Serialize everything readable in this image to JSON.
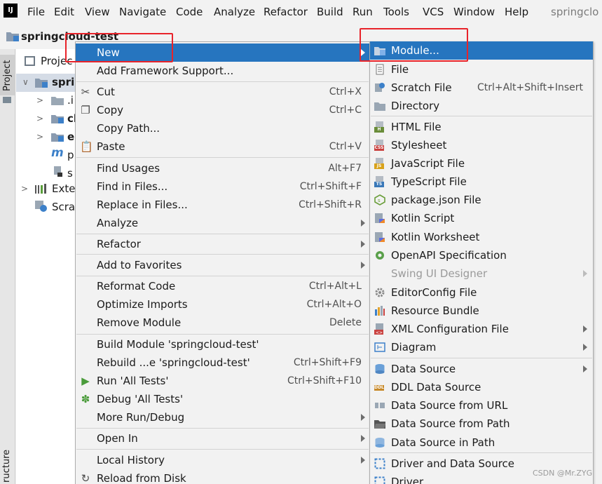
{
  "menubar": {
    "logo": "IJ",
    "items": [
      "File",
      "Edit",
      "View",
      "Navigate",
      "Code",
      "Analyze",
      "Refactor",
      "Build",
      "Run",
      "Tools",
      "VCS",
      "Window",
      "Help"
    ],
    "window_title": "springclo"
  },
  "breadcrumb": {
    "label": "springcloud-test"
  },
  "side_stripe": {
    "project": "Project",
    "structure": "ructure"
  },
  "project_panel": {
    "title": "Projec",
    "tree": [
      "sprin",
      ".i",
      "cl",
      "e",
      "p",
      "s",
      "Exter",
      "Scra"
    ]
  },
  "context_menu": {
    "items": [
      {
        "label": "New",
        "shortcut": ""
      },
      {
        "label": "Add Framework Support...",
        "shortcut": ""
      },
      {
        "label": "Cut",
        "shortcut": "Ctrl+X"
      },
      {
        "label": "Copy",
        "shortcut": "Ctrl+C"
      },
      {
        "label": "Copy Path...",
        "shortcut": ""
      },
      {
        "label": "Paste",
        "shortcut": "Ctrl+V"
      },
      {
        "label": "Find Usages",
        "shortcut": "Alt+F7"
      },
      {
        "label": "Find in Files...",
        "shortcut": "Ctrl+Shift+F"
      },
      {
        "label": "Replace in Files...",
        "shortcut": "Ctrl+Shift+R"
      },
      {
        "label": "Analyze",
        "shortcut": ""
      },
      {
        "label": "Refactor",
        "shortcut": ""
      },
      {
        "label": "Add to Favorites",
        "shortcut": ""
      },
      {
        "label": "Reformat Code",
        "shortcut": "Ctrl+Alt+L"
      },
      {
        "label": "Optimize Imports",
        "shortcut": "Ctrl+Alt+O"
      },
      {
        "label": "Remove Module",
        "shortcut": "Delete"
      },
      {
        "label": "Build Module 'springcloud-test'",
        "shortcut": ""
      },
      {
        "label": "Rebuild ...e 'springcloud-test'",
        "shortcut": "Ctrl+Shift+F9"
      },
      {
        "label": "Run 'All Tests'",
        "shortcut": "Ctrl+Shift+F10"
      },
      {
        "label": "Debug 'All Tests'",
        "shortcut": ""
      },
      {
        "label": "More Run/Debug",
        "shortcut": ""
      },
      {
        "label": "Open In",
        "shortcut": ""
      },
      {
        "label": "Local History",
        "shortcut": ""
      },
      {
        "label": "Reload from Disk",
        "shortcut": ""
      }
    ]
  },
  "new_submenu": {
    "items": [
      {
        "label": "Module...",
        "shortcut": ""
      },
      {
        "label": "File",
        "shortcut": ""
      },
      {
        "label": "Scratch File",
        "shortcut": "Ctrl+Alt+Shift+Insert"
      },
      {
        "label": "Directory",
        "shortcut": ""
      },
      {
        "label": "HTML File",
        "shortcut": ""
      },
      {
        "label": "Stylesheet",
        "shortcut": ""
      },
      {
        "label": "JavaScript File",
        "shortcut": ""
      },
      {
        "label": "TypeScript File",
        "shortcut": ""
      },
      {
        "label": "package.json File",
        "shortcut": ""
      },
      {
        "label": "Kotlin Script",
        "shortcut": ""
      },
      {
        "label": "Kotlin Worksheet",
        "shortcut": ""
      },
      {
        "label": "OpenAPI Specification",
        "shortcut": ""
      },
      {
        "label": "Swing UI Designer",
        "shortcut": ""
      },
      {
        "label": "EditorConfig File",
        "shortcut": ""
      },
      {
        "label": "Resource Bundle",
        "shortcut": ""
      },
      {
        "label": "XML Configuration File",
        "shortcut": ""
      },
      {
        "label": "Diagram",
        "shortcut": ""
      },
      {
        "label": "Data Source",
        "shortcut": ""
      },
      {
        "label": "DDL Data Source",
        "shortcut": ""
      },
      {
        "label": "Data Source from URL",
        "shortcut": ""
      },
      {
        "label": "Data Source from Path",
        "shortcut": ""
      },
      {
        "label": "Data Source in Path",
        "shortcut": ""
      },
      {
        "label": "Driver and Data Source",
        "shortcut": ""
      },
      {
        "label": "Driver",
        "shortcut": ""
      }
    ],
    "badges": {
      "html": "H",
      "css": "CSS",
      "js": "JS",
      "ts": "TS",
      "ddl": "DDL"
    }
  },
  "watermark": "CSDN @Mr.ZYG",
  "colors": {
    "highlight": "#2675bf",
    "annotation": "#e8232a",
    "folder": "#8a9bb0"
  }
}
